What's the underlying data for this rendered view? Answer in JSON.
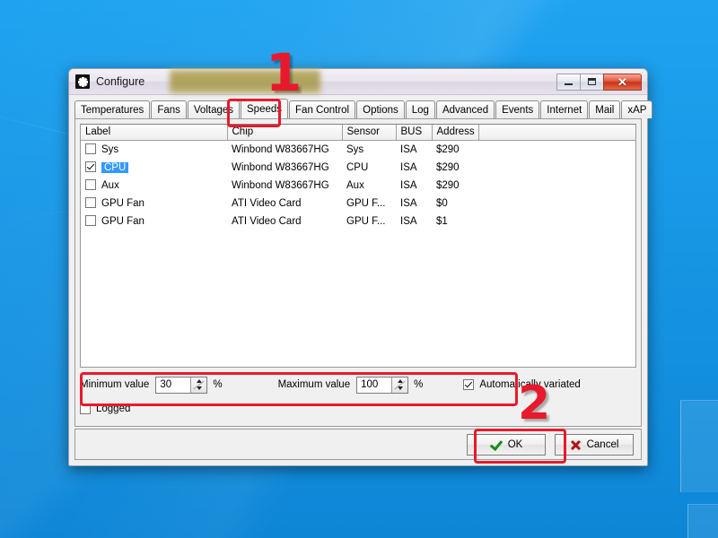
{
  "window": {
    "title": "Configure",
    "icon": "fan-icon",
    "minimize_label": "–",
    "maximize_label": "□",
    "close_label": "✕"
  },
  "tabs": [
    {
      "label": "Temperatures",
      "active": false
    },
    {
      "label": "Fans",
      "active": false
    },
    {
      "label": "Voltages",
      "active": false
    },
    {
      "label": "Speeds",
      "active": true
    },
    {
      "label": "Fan Control",
      "active": false
    },
    {
      "label": "Options",
      "active": false
    },
    {
      "label": "Log",
      "active": false
    },
    {
      "label": "Advanced",
      "active": false
    },
    {
      "label": "Events",
      "active": false
    },
    {
      "label": "Internet",
      "active": false
    },
    {
      "label": "Mail",
      "active": false
    },
    {
      "label": "xAP",
      "active": false
    }
  ],
  "table": {
    "columns": [
      "Label",
      "Chip",
      "Sensor",
      "BUS",
      "Address"
    ],
    "rows": [
      {
        "checked": false,
        "selected": false,
        "label": "Sys",
        "chip": "Winbond W83667HG",
        "sensor": "Sys",
        "bus": "ISA",
        "address": "$290"
      },
      {
        "checked": true,
        "selected": true,
        "label": "CPU",
        "chip": "Winbond W83667HG",
        "sensor": "CPU",
        "bus": "ISA",
        "address": "$290"
      },
      {
        "checked": false,
        "selected": false,
        "label": "Aux",
        "chip": "Winbond W83667HG",
        "sensor": "Aux",
        "bus": "ISA",
        "address": "$290"
      },
      {
        "checked": false,
        "selected": false,
        "label": "GPU Fan",
        "chip": "ATI Video Card",
        "sensor": "GPU F...",
        "bus": "ISA",
        "address": "$0"
      },
      {
        "checked": false,
        "selected": false,
        "label": "GPU Fan",
        "chip": "ATI Video Card",
        "sensor": "GPU F...",
        "bus": "ISA",
        "address": "$1"
      }
    ]
  },
  "controls": {
    "minimum_label": "Minimum value",
    "minimum_value": "30",
    "minimum_unit": "%",
    "maximum_label": "Maximum value",
    "maximum_value": "100",
    "maximum_unit": "%",
    "auto_variated_label": "Automatically variated",
    "auto_variated_checked": true,
    "logged_label": "Logged",
    "logged_checked": false
  },
  "buttons": {
    "ok_label": "OK",
    "cancel_label": "Cancel"
  },
  "annotations": {
    "marker_one": "1",
    "marker_two": "2",
    "highlight_color": "#e8192c"
  }
}
